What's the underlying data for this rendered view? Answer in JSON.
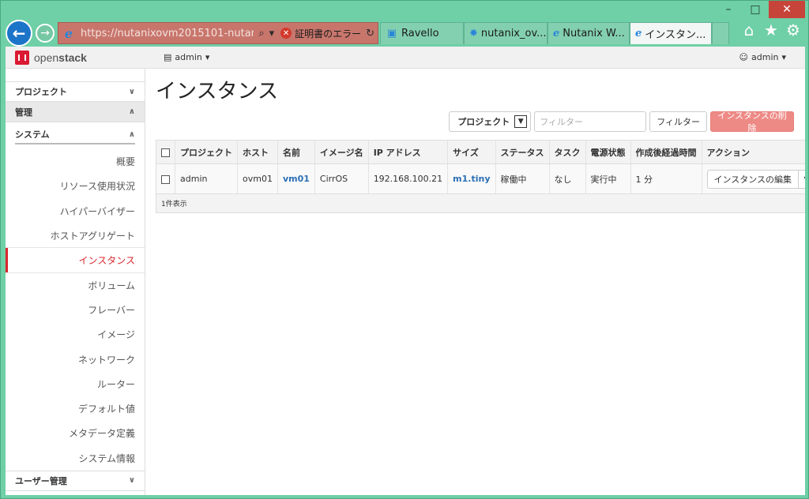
{
  "browser": {
    "url": "https://nutanixovm2015101-nutan...",
    "cert_error": "証明書のエラー",
    "tabs": [
      {
        "label": "Ravello",
        "icon": "ravello-icon"
      },
      {
        "label": "nutanix_ov...",
        "icon": "pinwheel-icon"
      },
      {
        "label": "Nutanix W...",
        "icon": "ie-icon"
      },
      {
        "label": "インスタン...",
        "icon": "ie-icon",
        "active": true
      }
    ]
  },
  "topnav": {
    "logo_prefix": "open",
    "logo_suffix": "stack",
    "project": "admin",
    "user": "admin"
  },
  "sidebar": {
    "project": "プロジェクト",
    "admin": "管理",
    "system": "システム",
    "items": [
      {
        "label": "概要"
      },
      {
        "label": "リソース使用状況"
      },
      {
        "label": "ハイパーバイザー"
      },
      {
        "label": "ホストアグリゲート"
      },
      {
        "label": "インスタンス",
        "active": true
      },
      {
        "label": "ボリューム"
      },
      {
        "label": "フレーバー"
      },
      {
        "label": "イメージ"
      },
      {
        "label": "ネットワーク"
      },
      {
        "label": "ルーター"
      },
      {
        "label": "デフォルト値"
      },
      {
        "label": "メタデータ定義"
      },
      {
        "label": "システム情報"
      }
    ],
    "user_mgmt": "ユーザー管理"
  },
  "main": {
    "title": "インスタンス",
    "filter_select": "プロジェクト",
    "filter_placeholder": "フィルター",
    "filter_button": "フィルター",
    "delete_button": "インスタンスの削除",
    "table": {
      "headers": [
        "プロジェクト",
        "ホスト",
        "名前",
        "イメージ名",
        "IP アドレス",
        "サイズ",
        "ステータス",
        "タスク",
        "電源状態",
        "作成後経過時間",
        "アクション"
      ],
      "rows": [
        {
          "project": "admin",
          "host": "ovm01",
          "name": "vm01",
          "image": "CirrOS",
          "ip": "192.168.100.21",
          "size": "m1.tiny",
          "status": "稼働中",
          "task": "なし",
          "power": "実行中",
          "age": "1 分",
          "action": "インスタンスの編集"
        }
      ],
      "footer": "1件表示"
    }
  },
  "colors": {
    "accent": "#d9262c",
    "link": "#2a6fb6",
    "danger_button": "#ee8a86",
    "window_frame": "#6fcfa6"
  }
}
